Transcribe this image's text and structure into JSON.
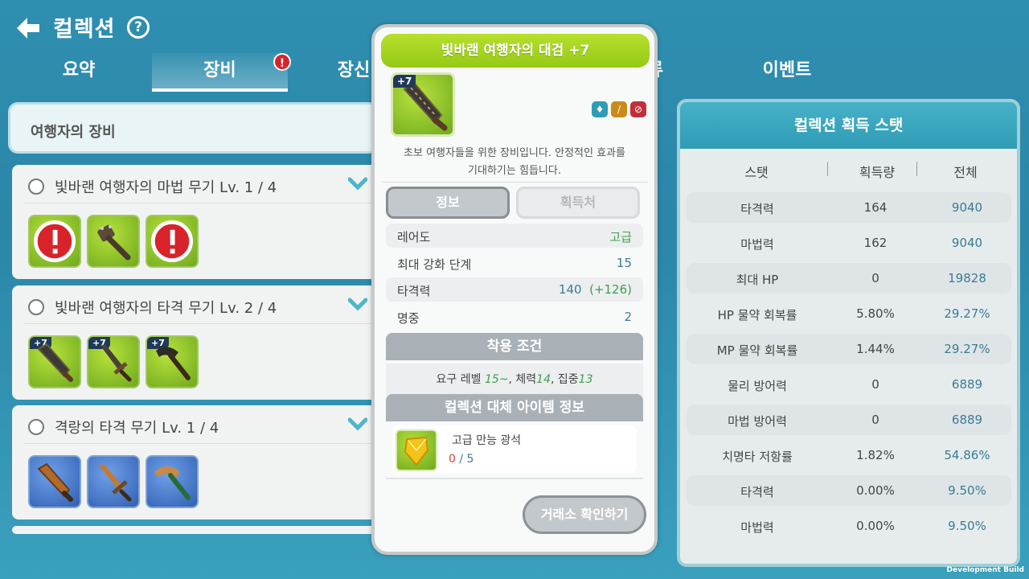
{
  "header": {
    "title": "컬렉션",
    "help": "?"
  },
  "tabs": [
    {
      "label": "요약"
    },
    {
      "label": "장비"
    },
    {
      "label": "장신"
    },
    {
      "label": "류"
    },
    {
      "label": "이벤트"
    }
  ],
  "left": {
    "section_title": "여행자의 장비",
    "collections": [
      {
        "name": "빛바랜 여행자의 마법 무기 Lv. 1 / 4"
      },
      {
        "name": "빛바랜 여행자의 타격 무기 Lv. 2 / 4"
      },
      {
        "name": "격랑의 타격 무기 Lv. 1 / 4"
      }
    ],
    "enhance_badge": "+7",
    "alert": "!"
  },
  "right": {
    "title": "컬렉션 획득 스탯",
    "headers": [
      "스탯",
      "획득량",
      "전체"
    ],
    "rows": [
      [
        "타격력",
        "164",
        "9040"
      ],
      [
        "마법력",
        "162",
        "9040"
      ],
      [
        "최대 HP",
        "0",
        "19828"
      ],
      [
        "HP 물약 회복률",
        "5.80%",
        "29.27%"
      ],
      [
        "MP 물약 회복률",
        "1.44%",
        "29.27%"
      ],
      [
        "물리 방어력",
        "0",
        "6889"
      ],
      [
        "마법 방어력",
        "0",
        "6889"
      ],
      [
        "치명타 저항률",
        "1.82%",
        "54.86%"
      ],
      [
        "타격력",
        "0.00%",
        "9.50%"
      ],
      [
        "마법력",
        "0.00%",
        "9.50%"
      ]
    ]
  },
  "modal": {
    "title": "빛바랜 여행자의 대검 +7",
    "enhance": "+7",
    "description_line1": "초보 여행자들을 위한 장비입니다. 안정적인 효과를",
    "description_line2": "기대하기는 힘듭니다.",
    "tab_info": "정보",
    "tab_source": "획득처",
    "info": [
      {
        "key": "레어도",
        "value": "고급"
      },
      {
        "key": "최대 강화 단계",
        "value": "15"
      },
      {
        "key": "타격력",
        "value": "140",
        "bonus": "(+126)"
      },
      {
        "key": "명중",
        "value": "2"
      }
    ],
    "equip_condition_title": "착용 조건",
    "requirement": {
      "level_label": "요구 레벨",
      "level_value": "15~",
      "str_label": "체력",
      "str_value": "14",
      "focus_label": "집중",
      "focus_value": "13"
    },
    "alt_item_title": "컬렉션 대체 아이템 정보",
    "alt_item": {
      "name": "고급 만능 광석",
      "have": "0",
      "need": "5"
    },
    "market_button": "거래소 확인하기"
  },
  "footer": {
    "dev_build": "Development Build"
  },
  "colors": {
    "accent_green": "#9ccc1a",
    "teal": "#2f9cb6",
    "alert_red": "#d8232a"
  }
}
